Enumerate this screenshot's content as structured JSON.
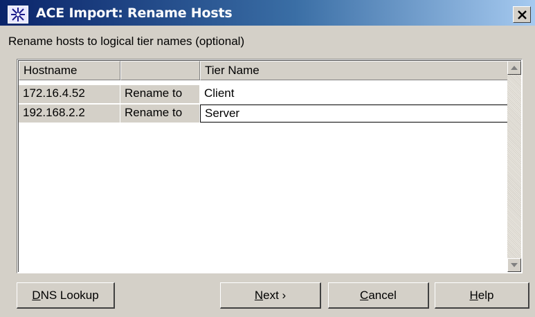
{
  "window": {
    "title": "ACE Import: Rename Hosts",
    "app_icon": "star-burst-icon",
    "close_icon": "close-icon"
  },
  "subtitle": "Rename hosts to logical tier names (optional)",
  "grid": {
    "columns": [
      "Hostname",
      "",
      "Tier Name"
    ],
    "rows": [
      {
        "hostname": "172.16.4.52",
        "action": "Rename to",
        "tier": "Client"
      },
      {
        "hostname": "192.168.2.2",
        "action": "Rename to",
        "tier": "Server"
      }
    ]
  },
  "buttons": {
    "dns": {
      "mnemonic": "D",
      "rest": "NS Lookup"
    },
    "next": {
      "mnemonic": "N",
      "rest": "ext ›"
    },
    "cancel": {
      "mnemonic": "C",
      "rest": "ancel"
    },
    "help": {
      "mnemonic": "H",
      "rest": "elp"
    }
  }
}
